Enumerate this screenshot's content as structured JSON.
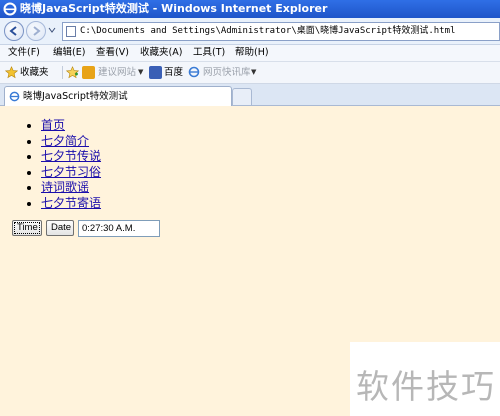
{
  "window": {
    "title": "晓博JavaScript特效测试 - Windows Internet Explorer"
  },
  "address": {
    "url": "C:\\Documents and Settings\\Administrator\\桌面\\晓博JavaScript特效测试.html"
  },
  "menu": {
    "file": "文件(F)",
    "edit": "编辑(E)",
    "view": "查看(V)",
    "favorites": "收藏夹(A)",
    "tools": "工具(T)",
    "help": "帮助(H)"
  },
  "favorites_bar": {
    "favorites_label": "收藏夹",
    "suggested_sites": "建议网站",
    "baidu": "百度",
    "web_slices": "网页快讯库"
  },
  "tab": {
    "title": "晓博JavaScript特效测试"
  },
  "page": {
    "links": [
      "首页",
      "七夕简介",
      "七夕节传说",
      "七夕节习俗",
      "诗词歌谣",
      "七夕节寄语"
    ],
    "time_button": "Time",
    "date_button": "Date",
    "time_value": "0:27:30 A.M."
  },
  "watermark": {
    "text": "软件技巧"
  }
}
